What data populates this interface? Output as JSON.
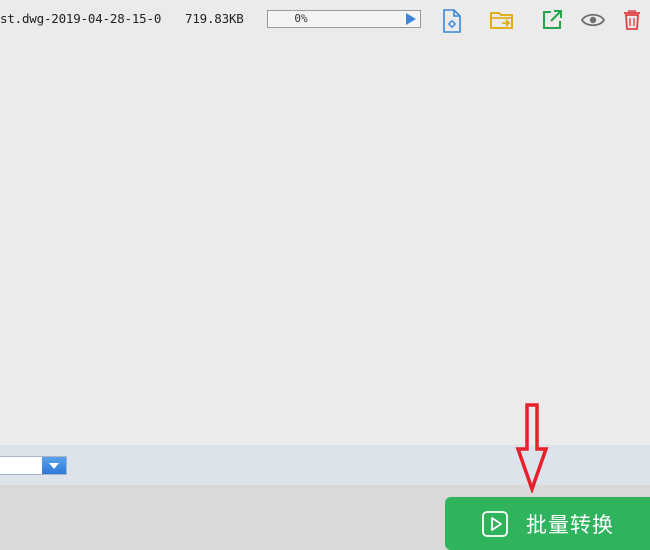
{
  "file_row": {
    "file_name": "st.dwg-2019-04-28-15-0",
    "file_size": "719.83KB",
    "progress_text": "0%",
    "progress_value": 0,
    "actions": [
      {
        "name": "file-settings-icon",
        "color": "#3d86dc"
      },
      {
        "name": "open-folder-icon",
        "color": "#e0a500"
      },
      {
        "name": "open-external-icon",
        "color": "#22a64a"
      },
      {
        "name": "preview-eye-icon",
        "color": "#707070"
      },
      {
        "name": "delete-trash-icon",
        "color": "#e04444"
      }
    ]
  },
  "settings_strip": {
    "select_value": ""
  },
  "bottom_bar": {
    "convert_button_label": "批量转换",
    "convert_button_color": "#2fb35d"
  },
  "annotation": {
    "arrow_color": "#e8202a",
    "arrow_icon": "down-arrow-icon"
  }
}
